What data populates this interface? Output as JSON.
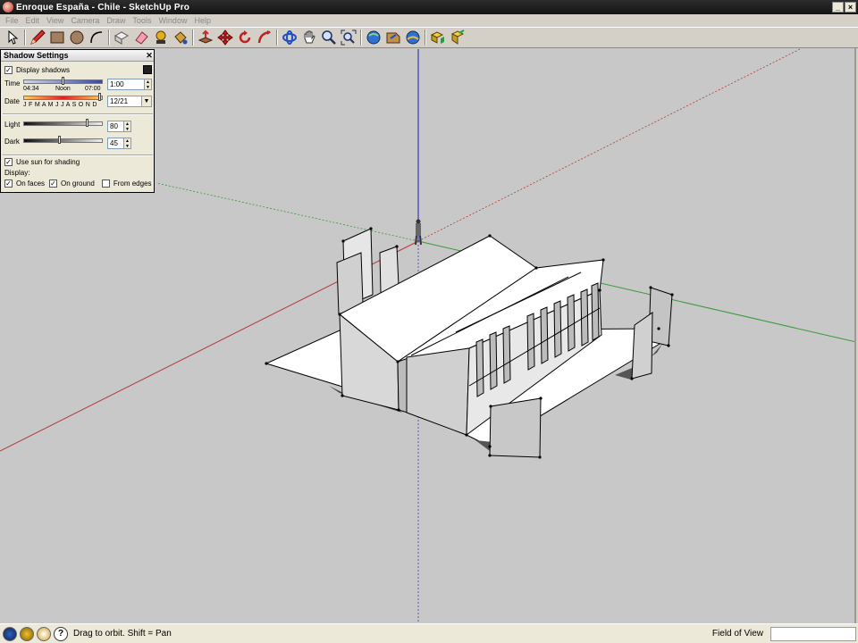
{
  "window": {
    "title": "Enroque España - Chile - SketchUp Pro",
    "minimize": "_",
    "close": "×"
  },
  "menu": [
    "File",
    "Edit",
    "View",
    "Camera",
    "Draw",
    "Tools",
    "Window",
    "Help"
  ],
  "toolbar": {
    "tools": [
      "select-tool",
      "pencil-tool",
      "rectangle-tool",
      "circle-tool",
      "arc-tool",
      "eraser-tool",
      "paint-bucket-tool",
      "tape-measure-tool",
      "push-pull-tool",
      "offset-tool",
      "move-tool",
      "rotate-tool",
      "follow-me-tool",
      "orbit-tool",
      "pan-tool",
      "zoom-tool",
      "zoom-extents-tool",
      "get-models-tool",
      "share-model-tool",
      "geolocate-tool",
      "components-tool",
      "extension-tool"
    ]
  },
  "shadow_panel": {
    "title": "Shadow Settings",
    "display_shadows": "Display shadows",
    "time_label": "Time",
    "time_start": "04:34",
    "time_noon": "Noon",
    "time_end": "07:00",
    "time_value": "1:00",
    "date_label": "Date",
    "months": "J F M A M J J A S O N D",
    "date_value": "12/21",
    "light_label": "Light",
    "light_value": "80",
    "dark_label": "Dark",
    "dark_value": "45",
    "use_sun": "Use sun for shading",
    "display_label": "Display:",
    "on_faces": "On faces",
    "on_ground": "On ground",
    "from_edges": "From edges",
    "display_shadows_checked": true,
    "use_sun_checked": true,
    "on_faces_checked": true,
    "on_ground_checked": true,
    "from_edges_checked": false,
    "light_level_pct": 80,
    "dark_level_pct": 45,
    "colors": {
      "axis_red": "#b33a3a",
      "axis_green": "#3a9a3a",
      "axis_blue": "#3a3ab3"
    }
  },
  "status": {
    "hint": "Drag to orbit.  Shift = Pan",
    "measure_label": "Field of View",
    "measure_value": ""
  }
}
